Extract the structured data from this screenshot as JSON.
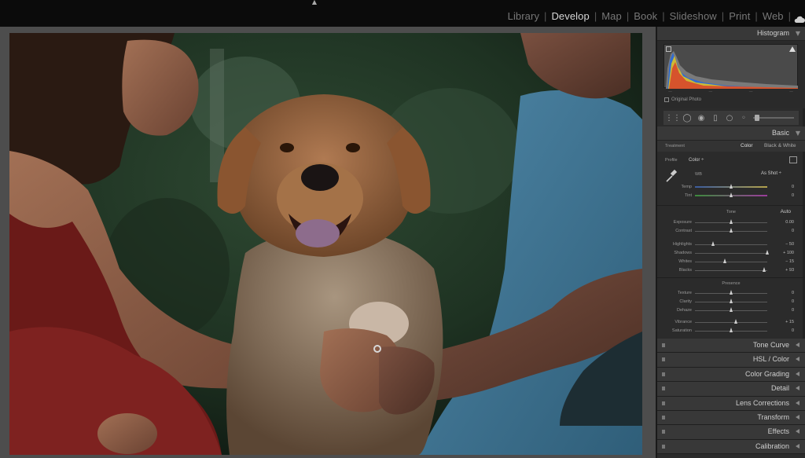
{
  "modules": {
    "items": [
      "Library",
      "Develop",
      "Map",
      "Book",
      "Slideshow",
      "Print",
      "Web"
    ],
    "active": "Develop"
  },
  "icons": {
    "top_arrow": "expand-arrow-icon",
    "cloud": "cloud-icon",
    "eyedropper": "eyedropper-icon",
    "profile_grid": "grid-icon"
  },
  "colors": {
    "background": "#4d4d4d",
    "panel": "#2b2b2b",
    "header": "#383838"
  },
  "histogram": {
    "title": "Histogram",
    "original_photo_label": "Original Photo"
  },
  "basic": {
    "title": "Basic",
    "treatment_label": "Treatment",
    "treatment_color": "Color",
    "treatment_bw": "Black & White",
    "profile_label": "Profile",
    "profile_value": "Color",
    "wb_label": "WB",
    "wb_value": "As Shot",
    "tone_label": "Tone",
    "auto_label": "Auto",
    "presence_label": "Presence",
    "sliders": {
      "temp": {
        "label": "Temp",
        "value": "0",
        "pos": 0.5
      },
      "tint": {
        "label": "Tint",
        "value": "0",
        "pos": 0.5
      },
      "exposure": {
        "label": "Exposure",
        "value": "0.00",
        "pos": 0.5
      },
      "contrast": {
        "label": "Contrast",
        "value": "0",
        "pos": 0.5
      },
      "highlights": {
        "label": "Highlights",
        "value": "− 50",
        "pos": 0.25
      },
      "shadows": {
        "label": "Shadows",
        "value": "+ 100",
        "pos": 1.0
      },
      "whites": {
        "label": "Whites",
        "value": "− 15",
        "pos": 0.42
      },
      "blacks": {
        "label": "Blacks",
        "value": "+ 93",
        "pos": 0.96
      },
      "texture": {
        "label": "Texture",
        "value": "0",
        "pos": 0.5
      },
      "clarity": {
        "label": "Clarity",
        "value": "0",
        "pos": 0.5
      },
      "dehaze": {
        "label": "Dehaze",
        "value": "0",
        "pos": 0.5
      },
      "vibrance": {
        "label": "Vibrance",
        "value": "+ 15",
        "pos": 0.57
      },
      "saturation": {
        "label": "Saturation",
        "value": "0",
        "pos": 0.5
      }
    }
  },
  "panels": [
    "Tone Curve",
    "HSL / Color",
    "Color Grading",
    "Detail",
    "Lens Corrections",
    "Transform",
    "Effects",
    "Calibration"
  ]
}
